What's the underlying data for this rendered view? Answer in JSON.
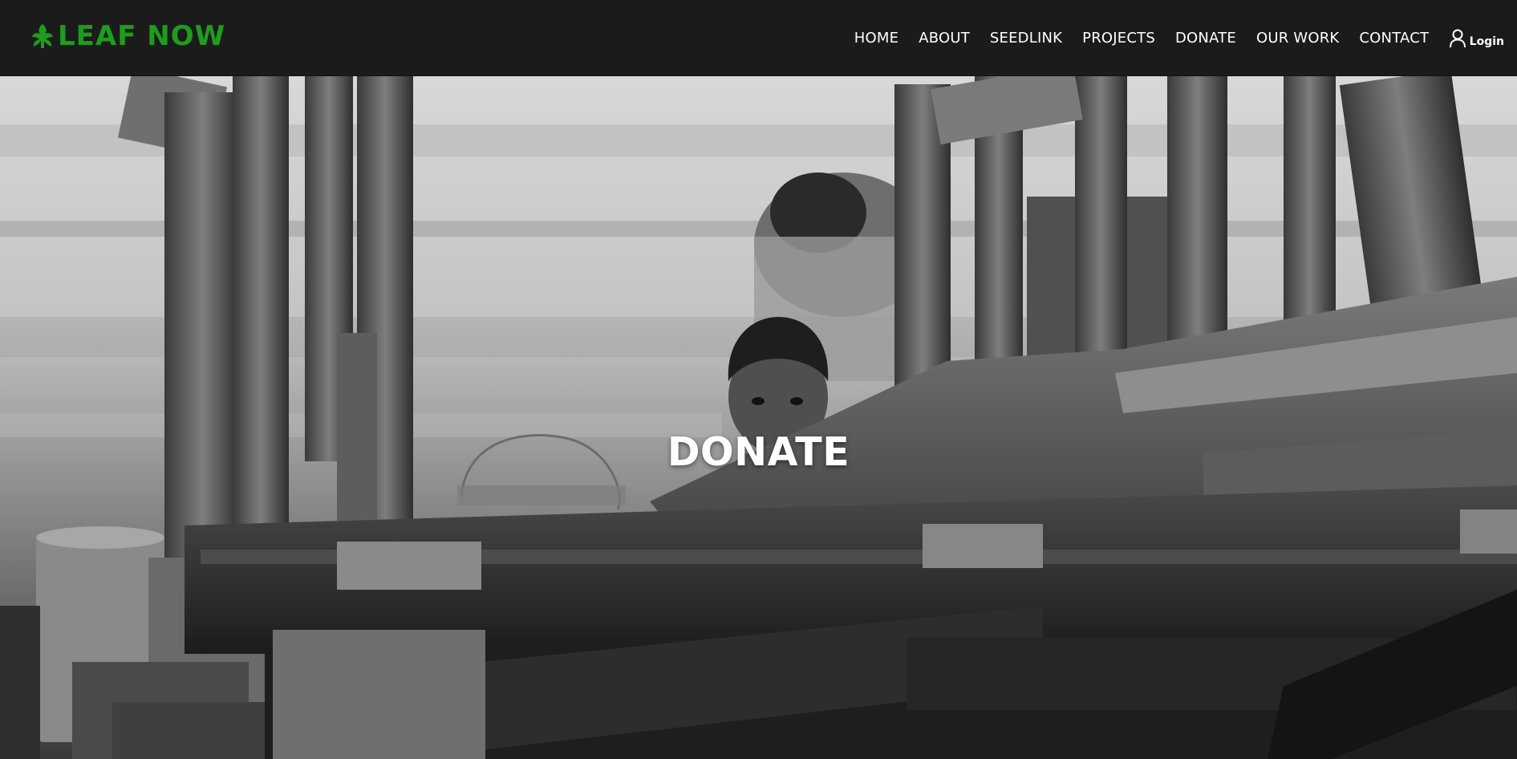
{
  "brand": {
    "name": "LEAF NOW",
    "icon": "leaf-icon",
    "color": "#1e9c1e"
  },
  "nav": {
    "items": [
      {
        "label": "HOME"
      },
      {
        "label": "ABOUT"
      },
      {
        "label": "SEEDLINK"
      },
      {
        "label": "PROJECTS"
      },
      {
        "label": "DONATE"
      },
      {
        "label": "OUR WORK"
      },
      {
        "label": "CONTACT"
      }
    ],
    "login": {
      "label": "Login",
      "icon": "user-icon"
    }
  },
  "hero": {
    "title": "DONATE",
    "image": "black-and-white-photo-boy-behind-wooden-planks"
  },
  "colors": {
    "header_bg": "#1b1b1b",
    "nav_text": "#ffffff"
  }
}
